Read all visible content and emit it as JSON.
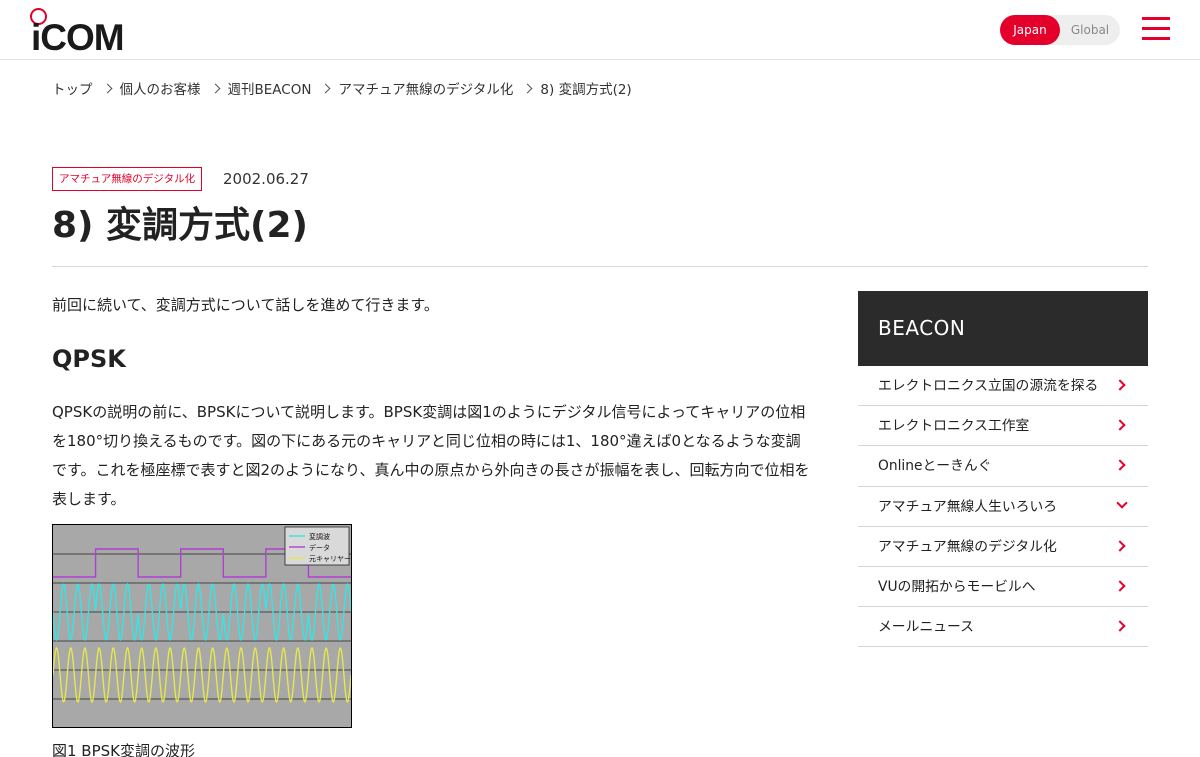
{
  "header": {
    "logo_text": "iCOM",
    "lang": {
      "japan": "Japan",
      "global": "Global"
    }
  },
  "breadcrumb": [
    "トップ",
    "個人のお客様",
    "週刊BEACON",
    "アマチュア無線のデジタル化",
    "8) 変調方式(2)"
  ],
  "article": {
    "tag": "アマチュア無線のデジタル化",
    "date": "2002.06.27",
    "title": "8) 変調方式(2)",
    "intro": "前回に続いて、変調方式について話しを進めて行きます。",
    "section_heading": "QPSK",
    "paragraph": "QPSKの説明の前に、BPSKについて説明します。BPSK変調は図1のようにデジタル信号によってキャリアの位相を180°切り換えるものです。図の下にある元のキャリアと同じ位相の時には1、180°違えば0となるような変調です。これを極座標で表すと図2のようになり、真ん中の原点から外向きの長さが振幅を表し、回転方向で位相を表します。",
    "figure": {
      "legend": [
        "変調波",
        "データ",
        "元キャリヤー"
      ],
      "colors": {
        "modulated": "#33e6e6",
        "data": "#b040d0",
        "carrier": "#e6e64d",
        "background": "#a8a8a8"
      },
      "data_bits": [
        0,
        1,
        0,
        1,
        0,
        1,
        0
      ],
      "caption": "図1 BPSK変調の波形"
    }
  },
  "sidebar": {
    "title": "BEACON",
    "items": [
      {
        "label": "エレクトロニクス立国の源流を探る",
        "icon": "chevron-right-icon"
      },
      {
        "label": "エレクトロニクス工作室",
        "icon": "chevron-right-icon"
      },
      {
        "label": "Onlineとーきんぐ",
        "icon": "chevron-right-icon"
      },
      {
        "label": "アマチュア無線人生いろいろ",
        "icon": "chevron-down-icon"
      },
      {
        "label": "アマチュア無線のデジタル化",
        "icon": "chevron-right-icon"
      },
      {
        "label": "VUの開拓からモービルへ",
        "icon": "chevron-right-icon"
      },
      {
        "label": "メールニュース",
        "icon": "chevron-right-icon"
      }
    ]
  }
}
